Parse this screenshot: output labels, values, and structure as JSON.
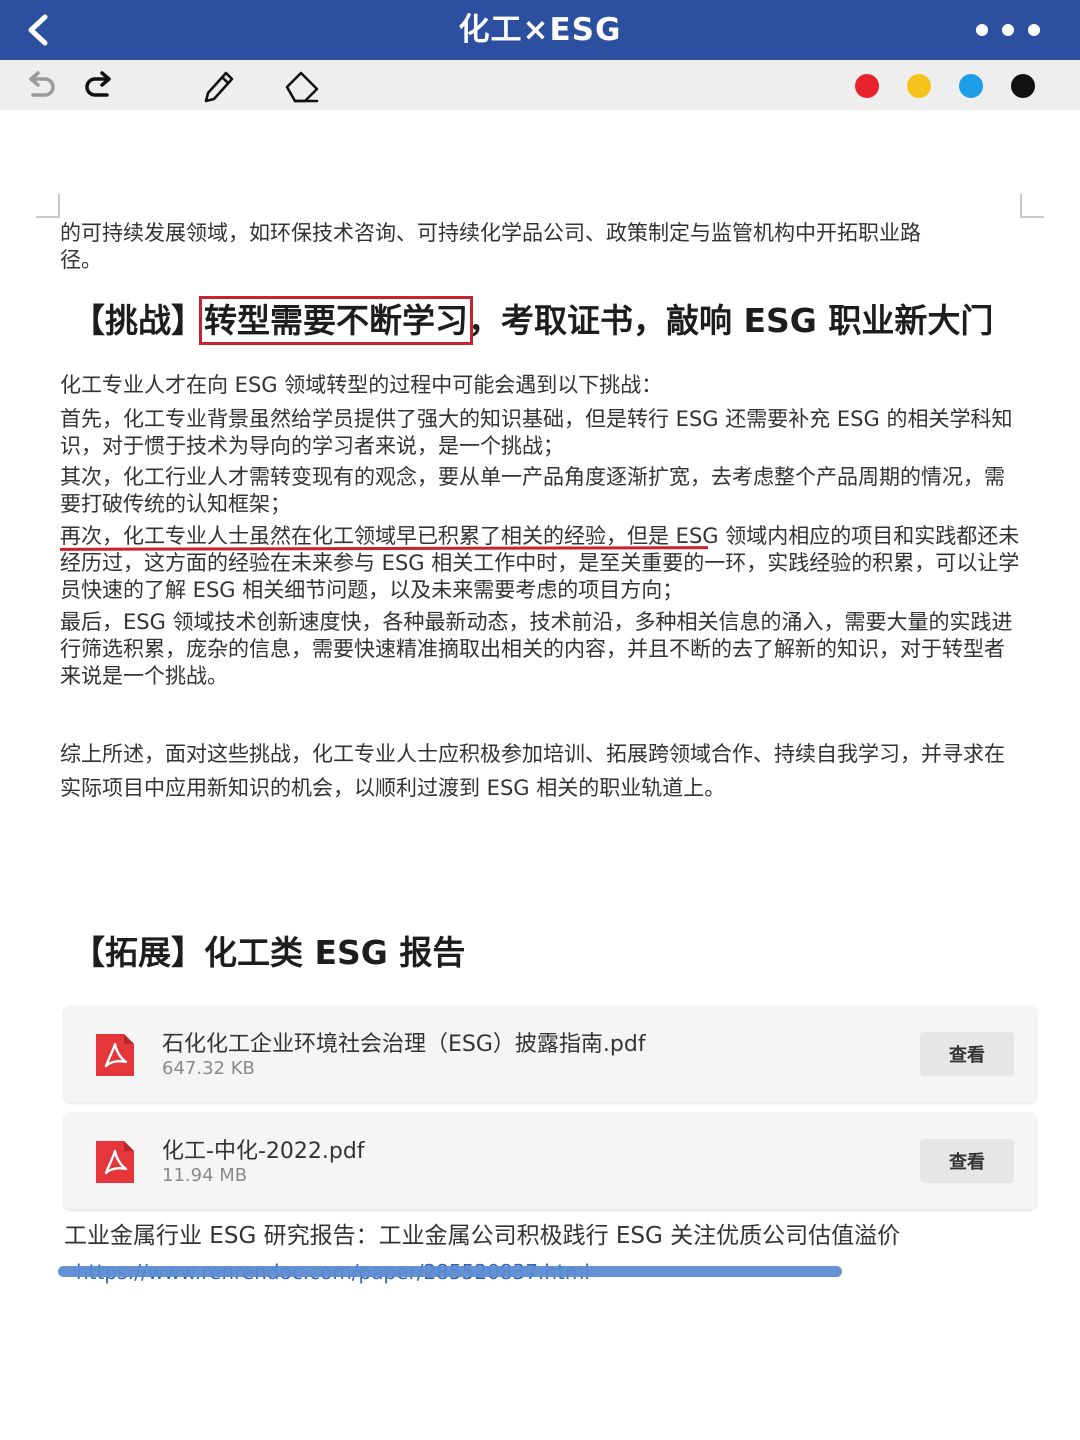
{
  "header": {
    "title": "化工×ESG"
  },
  "toolbar": {
    "tools": [
      "undo-icon",
      "redo-icon",
      "pencil-icon",
      "eraser-icon"
    ],
    "colors": [
      "#e8232d",
      "#f6c31c",
      "#1f9ee8",
      "#111111"
    ]
  },
  "document": {
    "para_intro_line1": "的可持续发展领域，如环保技术咨询、可持续化学品公司、政策制定与监管机构中开拓职业路",
    "para_intro_line2": "径。",
    "challenge_heading": {
      "prefix": "【挑战】",
      "boxed": "转型需要不断学习",
      "suffix": "，考取证书，敲响 ESG 职业新大门"
    },
    "challenges_intro": "化工专业人才在向 ESG 领域转型的过程中可能会遇到以下挑战：",
    "challenge_1": "首先，化工专业背景虽然给学员提供了强大的知识基础，但是转行 ESG 还需要补充 ESG 的相关学科知识，对于惯于技术为导向的学习者来说，是一个挑战；",
    "challenge_2": "其次，化工行业人才需转变现有的观念，要从单一产品角度逐渐扩宽，去考虑整个产品周期的情况，需要打破传统的认知框架；",
    "challenge_3": "再次，化工专业人士虽然在化工领域早已积累了相关的经验，但是 ESG 领域内相应的项目和实践都还未经历过，这方面的经验在未来参与 ESG 相关工作中时，是至关重要的一环，实践经验的积累，可以让学员快速的了解 ESG 相关细节问题，以及未来需要考虑的项目方向；",
    "challenge_4": "最后，ESG 领域技术创新速度快，各种最新动态，技术前沿，多种相关信息的涌入，需要大量的实践进行筛选积累，庞杂的信息，需要快速精准摘取出相关的内容，并且不断的去了解新的知识，对于转型者来说是一个挑战。",
    "conclusion": "综上所述，面对这些挑战，化工专业人士应积极参加培训、拓展跨领域合作、持续自我学习，并寻求在实际项目中应用新知识的机会，以顺利过渡到 ESG 相关的职业轨道上。",
    "extension_heading": "【拓展】化工类 ESG 报告",
    "files": [
      {
        "name": "石化化工企业环境社会治理（ESG）披露指南.pdf",
        "size": "647.32 KB",
        "action": "查看"
      },
      {
        "name": "化工-中化-2022.pdf",
        "size": "11.94 MB",
        "action": "查看"
      }
    ],
    "report_title": "工业金属行业 ESG 研究报告：工业金属公司积极践行 ESG 关注优质公司估值溢价",
    "report_link": "https://www.renrendoc.com/paper/285520837.html"
  }
}
